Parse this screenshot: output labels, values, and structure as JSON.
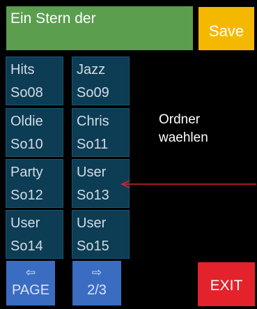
{
  "header": {
    "title": "Ein Stern der",
    "save_label": "Save"
  },
  "folders": [
    {
      "name": "Hits",
      "code": "So08"
    },
    {
      "name": "Jazz",
      "code": "So09"
    },
    {
      "name": "Oldie",
      "code": "So10"
    },
    {
      "name": "Chris",
      "code": "So11"
    },
    {
      "name": "Party",
      "code": "So12"
    },
    {
      "name": "User",
      "code": "So13"
    },
    {
      "name": "User",
      "code": "So14"
    },
    {
      "name": "User",
      "code": "So15"
    }
  ],
  "hint": {
    "line1": "Ordner",
    "line2": "waehlen"
  },
  "footer": {
    "page_prev_icon": "⇦",
    "page_label": "PAGE",
    "page_next_icon": "⇨",
    "page_counter": "2/3",
    "exit_label": "EXIT"
  },
  "colors": {
    "title_bg": "#5a9e4e",
    "save_bg": "#f5b800",
    "folder_bg": "#0d3c55",
    "nav_bg": "#3a6cc2",
    "exit_bg": "#e3222b",
    "arrow": "#d8222b"
  }
}
